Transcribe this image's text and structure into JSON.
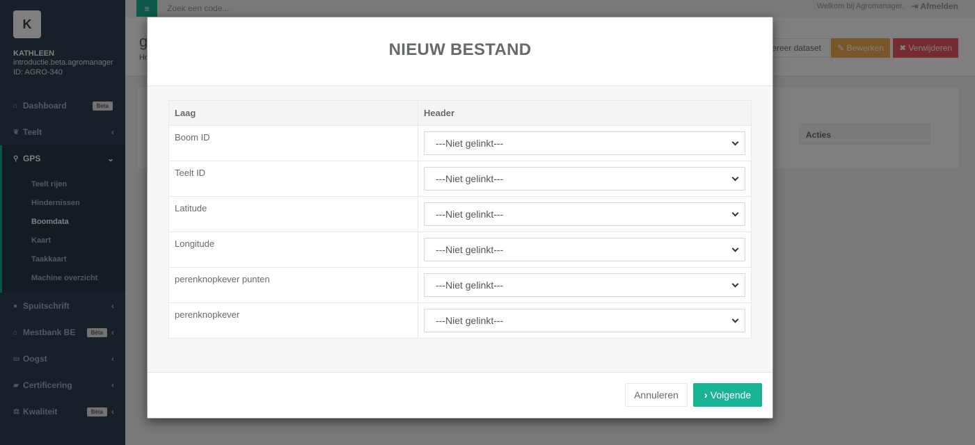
{
  "topbar": {
    "search_placeholder": "Zoek een code...",
    "welcome": "Welkom bij Agromanager.",
    "logout": "Afmelden"
  },
  "profile": {
    "logo_letter": "K",
    "name": "KATHLEEN",
    "domain": "introductie.beta.agromanager",
    "id": "ID: AGRO-340"
  },
  "sidebar": {
    "items": [
      {
        "label": "Dashboard",
        "badge": "Beta"
      },
      {
        "label": "Teelt"
      },
      {
        "label": "GPS"
      },
      {
        "label": "Spuitschrift"
      },
      {
        "label": "Mestbank BE",
        "badge": "Bèta"
      },
      {
        "label": "Oogst"
      },
      {
        "label": "Certificering"
      },
      {
        "label": "Kwaliteit",
        "badge": "Bèta"
      }
    ],
    "gps_sub": [
      "Teelt rijen",
      "Hindernissen",
      "Boomdata",
      "Kaart",
      "Taakkaart",
      "Machine overzicht"
    ]
  },
  "page": {
    "title_fragment": "g",
    "crumb_fragment": "Ho",
    "export_label": "ereer dataset",
    "edit_label": "Bewerken",
    "delete_label": "Verwijderen",
    "actions_header": "Acties"
  },
  "modal": {
    "title": "NIEUW BESTAND",
    "columns": [
      "Laag",
      "Header"
    ],
    "rows": [
      {
        "layer": "Boom ID",
        "value": "---Niet gelinkt---"
      },
      {
        "layer": "Teelt ID",
        "value": "---Niet gelinkt---"
      },
      {
        "layer": "Latitude",
        "value": "---Niet gelinkt---"
      },
      {
        "layer": "Longitude",
        "value": "---Niet gelinkt---"
      },
      {
        "layer": "perenknopkever punten",
        "value": "---Niet gelinkt---"
      },
      {
        "layer": "perenknopkever",
        "value": "---Niet gelinkt---"
      }
    ],
    "cancel_label": "Annuleren",
    "next_label": "Volgende"
  },
  "colors": {
    "accent": "#1ab394",
    "sidebar_bg": "#2f4050"
  }
}
